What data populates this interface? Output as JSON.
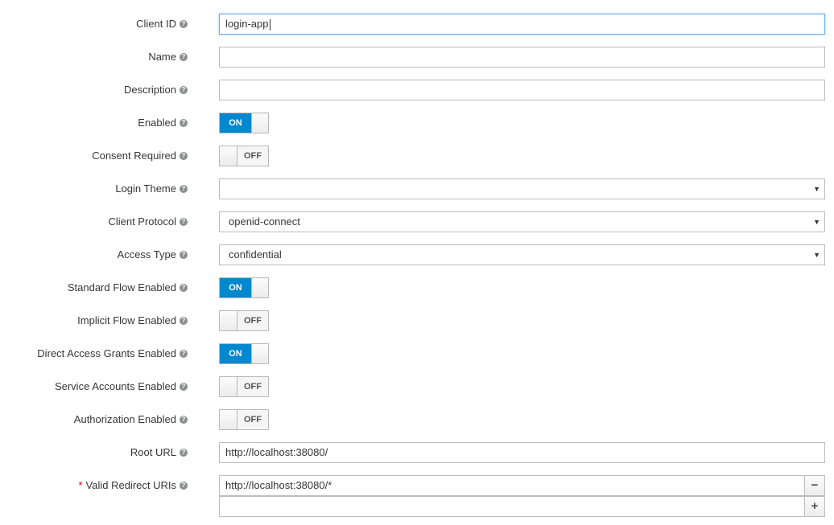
{
  "colors": {
    "accent": "#0088ce",
    "required": "#cc0000"
  },
  "help_icon": "question-circle-icon",
  "fields": {
    "client_id": {
      "label": "Client ID",
      "value": "login-app"
    },
    "name": {
      "label": "Name",
      "value": ""
    },
    "description": {
      "label": "Description",
      "value": ""
    },
    "enabled": {
      "label": "Enabled",
      "state": "ON"
    },
    "consent_required": {
      "label": "Consent Required",
      "state": "OFF"
    },
    "login_theme": {
      "label": "Login Theme",
      "value": ""
    },
    "client_protocol": {
      "label": "Client Protocol",
      "value": "openid-connect"
    },
    "access_type": {
      "label": "Access Type",
      "value": "confidential"
    },
    "standard_flow": {
      "label": "Standard Flow Enabled",
      "state": "ON"
    },
    "implicit_flow": {
      "label": "Implicit Flow Enabled",
      "state": "OFF"
    },
    "direct_access": {
      "label": "Direct Access Grants Enabled",
      "state": "ON"
    },
    "service_accounts": {
      "label": "Service Accounts Enabled",
      "state": "OFF"
    },
    "authorization": {
      "label": "Authorization Enabled",
      "state": "OFF"
    },
    "root_url": {
      "label": "Root URL",
      "value": "http://localhost:38080/"
    },
    "redirect_uris": {
      "required_marker": "*",
      "label": "Valid Redirect URIs",
      "values": [
        "http://localhost:38080/*",
        ""
      ],
      "remove_label": "−",
      "add_label": "+"
    }
  },
  "toggle_labels": {
    "on": "ON",
    "off": "OFF"
  },
  "select_arrow": "▼"
}
